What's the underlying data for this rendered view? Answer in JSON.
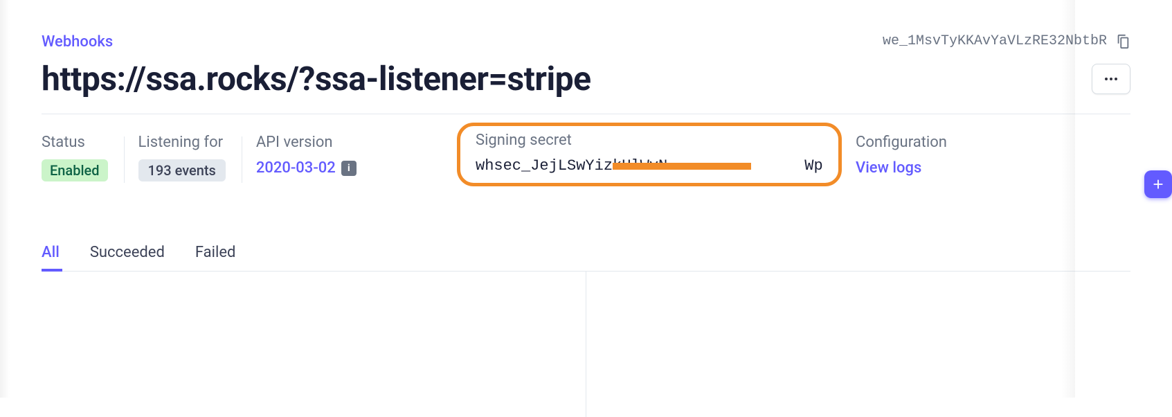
{
  "breadcrumb": "Webhooks",
  "endpoint_id": "we_1MsvTyKKAvYaVLzRE32NbtbR",
  "endpoint_url": "https://ssa.rocks/?ssa-listener=stripe",
  "info": {
    "status_label": "Status",
    "status_value": "Enabled",
    "listening_label": "Listening for",
    "listening_value": "193 events",
    "api_label": "API version",
    "api_value": "2020-03-02",
    "signing_label": "Signing secret",
    "signing_value_pre": "whsec_JejLSwYizkUlWvN",
    "signing_value_post": "Wp",
    "config_label": "Configuration",
    "config_link": "View logs"
  },
  "tabs": {
    "all": "All",
    "succeeded": "Succeeded",
    "failed": "Failed"
  }
}
